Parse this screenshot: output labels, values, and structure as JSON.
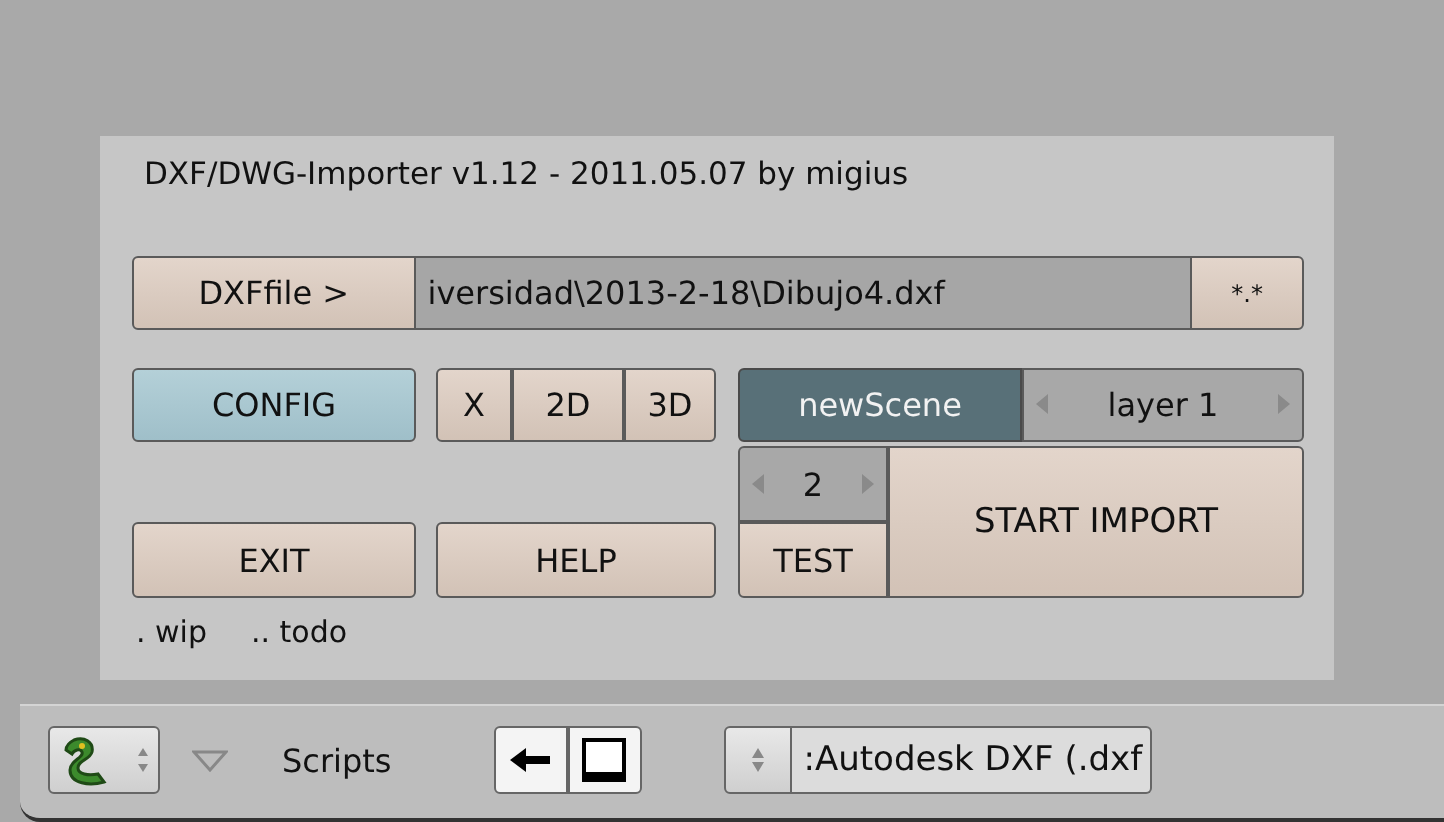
{
  "panel": {
    "title": "DXF/DWG-Importer v1.12 - 2011.05.07 by migius",
    "file_button": "DXFfile >",
    "file_path": "iversidad\\2013-2-18\\Dibujo4.dxf",
    "filter_button": "*.*",
    "config_button": "CONFIG",
    "dimension_buttons": [
      "X",
      "2D",
      "3D"
    ],
    "scene_field": "newScene",
    "layer_spinner": "layer 1",
    "count_spinner": "2",
    "test_button": "TEST",
    "start_button": "START IMPORT",
    "exit_button": "EXIT",
    "help_button": "HELP",
    "notes": [
      ". wip",
      ".. todo"
    ]
  },
  "header": {
    "menu_label": "Scripts",
    "script_selector": ":Autodesk DXF (.dxf"
  }
}
